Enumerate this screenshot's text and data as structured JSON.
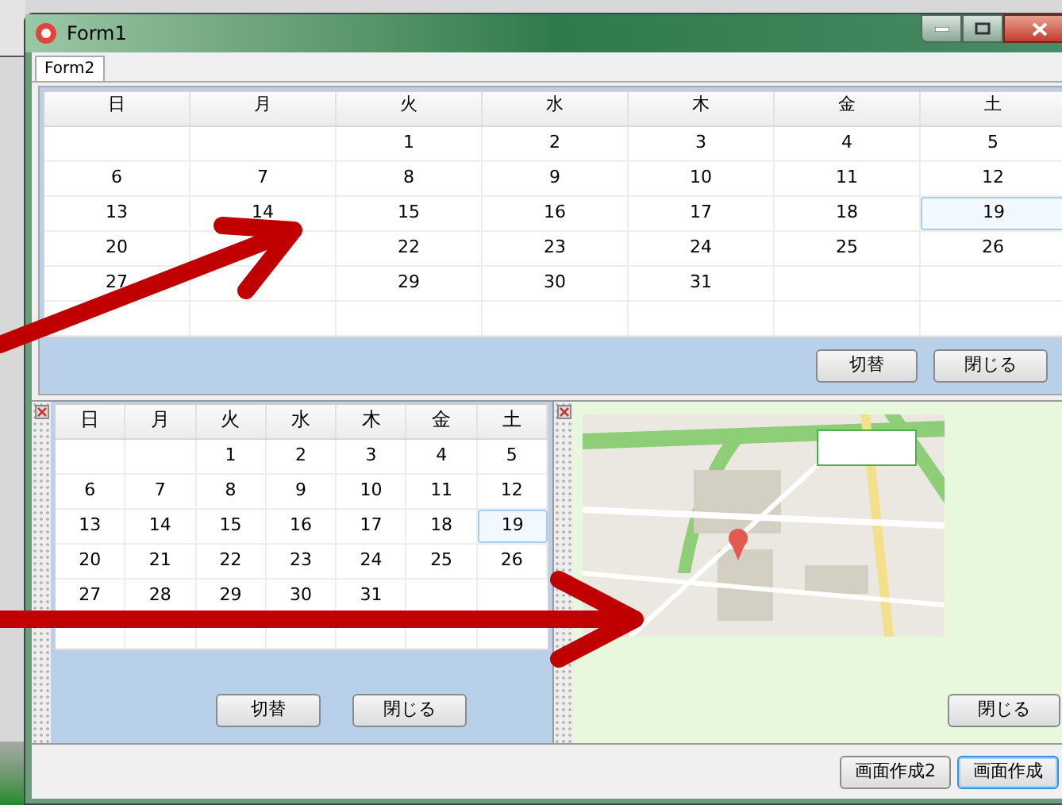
{
  "window": {
    "title": "Form1"
  },
  "tabs": [
    {
      "label": "Form2",
      "selected": true
    }
  ],
  "calendars": [
    {
      "weekdays": [
        "日",
        "月",
        "火",
        "水",
        "木",
        "金",
        "土"
      ],
      "weeks": [
        [
          {
            "kind": "blank"
          },
          {
            "kind": "blank"
          },
          {
            "kind": "day",
            "day": "1",
            "selected": false
          },
          {
            "kind": "day",
            "day": "2",
            "selected": false
          },
          {
            "kind": "day",
            "day": "3",
            "selected": false
          },
          {
            "kind": "day",
            "day": "4",
            "selected": false
          },
          {
            "kind": "day",
            "day": "5",
            "selected": false
          }
        ],
        [
          {
            "kind": "day",
            "day": "6",
            "selected": false
          },
          {
            "kind": "day",
            "day": "7",
            "selected": false
          },
          {
            "kind": "day",
            "day": "8",
            "selected": false
          },
          {
            "kind": "day",
            "day": "9",
            "selected": false
          },
          {
            "kind": "day",
            "day": "10",
            "selected": false
          },
          {
            "kind": "day",
            "day": "11",
            "selected": false
          },
          {
            "kind": "day",
            "day": "12",
            "selected": false
          }
        ],
        [
          {
            "kind": "day",
            "day": "13",
            "selected": false
          },
          {
            "kind": "day",
            "day": "14",
            "selected": false
          },
          {
            "kind": "day",
            "day": "15",
            "selected": false
          },
          {
            "kind": "day",
            "day": "16",
            "selected": false
          },
          {
            "kind": "day",
            "day": "17",
            "selected": false
          },
          {
            "kind": "day",
            "day": "18",
            "selected": false
          },
          {
            "kind": "day",
            "day": "19",
            "selected": true
          }
        ],
        [
          {
            "kind": "day",
            "day": "20",
            "selected": false
          },
          {
            "kind": "blank"
          },
          {
            "kind": "day",
            "day": "22",
            "selected": false
          },
          {
            "kind": "day",
            "day": "23",
            "selected": false
          },
          {
            "kind": "day",
            "day": "24",
            "selected": false
          },
          {
            "kind": "day",
            "day": "25",
            "selected": false
          },
          {
            "kind": "day",
            "day": "26",
            "selected": false
          }
        ],
        [
          {
            "kind": "day",
            "day": "27",
            "selected": false
          },
          {
            "kind": "blank"
          },
          {
            "kind": "day",
            "day": "29",
            "selected": false
          },
          {
            "kind": "day",
            "day": "30",
            "selected": false
          },
          {
            "kind": "day",
            "day": "31",
            "selected": false
          },
          {
            "kind": "blank"
          },
          {
            "kind": "blank"
          }
        ]
      ],
      "buttons": [
        {
          "label": "切替",
          "default": false
        },
        {
          "label": "閉じる",
          "default": false
        }
      ]
    },
    {
      "weekdays": [
        "日",
        "月",
        "火",
        "水",
        "木",
        "金",
        "土"
      ],
      "weeks": [
        [
          {
            "kind": "blank"
          },
          {
            "kind": "blank"
          },
          {
            "kind": "day",
            "day": "1",
            "selected": false
          },
          {
            "kind": "day",
            "day": "2",
            "selected": false
          },
          {
            "kind": "day",
            "day": "3",
            "selected": false
          },
          {
            "kind": "day",
            "day": "4",
            "selected": false
          },
          {
            "kind": "day",
            "day": "5",
            "selected": false
          }
        ],
        [
          {
            "kind": "day",
            "day": "6",
            "selected": false
          },
          {
            "kind": "day",
            "day": "7",
            "selected": false
          },
          {
            "kind": "day",
            "day": "8",
            "selected": false
          },
          {
            "kind": "day",
            "day": "9",
            "selected": false
          },
          {
            "kind": "day",
            "day": "10",
            "selected": false
          },
          {
            "kind": "day",
            "day": "11",
            "selected": false
          },
          {
            "kind": "day",
            "day": "12",
            "selected": false
          }
        ],
        [
          {
            "kind": "day",
            "day": "13",
            "selected": false
          },
          {
            "kind": "day",
            "day": "14",
            "selected": false
          },
          {
            "kind": "day",
            "day": "15",
            "selected": false
          },
          {
            "kind": "day",
            "day": "16",
            "selected": false
          },
          {
            "kind": "day",
            "day": "17",
            "selected": false
          },
          {
            "kind": "day",
            "day": "18",
            "selected": false
          },
          {
            "kind": "day",
            "day": "19",
            "selected": true
          }
        ],
        [
          {
            "kind": "day",
            "day": "20",
            "selected": false
          },
          {
            "kind": "day",
            "day": "21",
            "selected": false
          },
          {
            "kind": "day",
            "day": "22",
            "selected": false
          },
          {
            "kind": "day",
            "day": "23",
            "selected": false
          },
          {
            "kind": "day",
            "day": "24",
            "selected": false
          },
          {
            "kind": "day",
            "day": "25",
            "selected": false
          },
          {
            "kind": "day",
            "day": "26",
            "selected": false
          }
        ],
        [
          {
            "kind": "day",
            "day": "27",
            "selected": false
          },
          {
            "kind": "day",
            "day": "28",
            "selected": false
          },
          {
            "kind": "day",
            "day": "29",
            "selected": false
          },
          {
            "kind": "day",
            "day": "30",
            "selected": false
          },
          {
            "kind": "day",
            "day": "31",
            "selected": false
          },
          {
            "kind": "blank"
          },
          {
            "kind": "blank"
          }
        ]
      ],
      "buttons": [
        {
          "label": "切替",
          "default": false
        },
        {
          "label": "閉じる",
          "default": false
        }
      ]
    }
  ],
  "map_panel": {
    "buttons": [
      {
        "label": "閉じる",
        "default": false
      }
    ]
  },
  "footer": {
    "buttons": [
      {
        "label": "画面作成2",
        "default": false
      },
      {
        "label": "画面作成",
        "default": true
      }
    ]
  }
}
